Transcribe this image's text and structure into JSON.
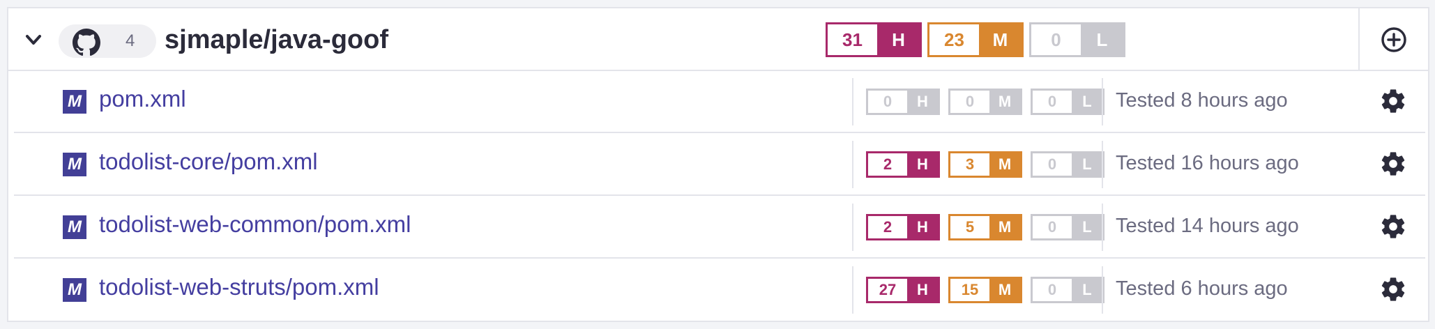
{
  "project": {
    "repo_count": "4",
    "repo_name": "sjmaple/java-goof",
    "issues": {
      "high": "31",
      "high_label": "H",
      "medium": "23",
      "medium_label": "M",
      "low": "0",
      "low_label": "L"
    }
  },
  "icons": {
    "collapse": "chevron-down-icon",
    "repo": "github-icon",
    "add": "plus-circle-icon",
    "file_type": "maven-icon",
    "settings": "gear-icon"
  },
  "file_icon_letter": "M",
  "colors": {
    "high": "#a8296a",
    "medium": "#d9872f",
    "low": "#c9c9cf",
    "link": "#443ea0",
    "maven_icon": "#423f96"
  },
  "files": [
    {
      "name": "pom.xml",
      "high": "0",
      "medium": "0",
      "low": "0",
      "h": "H",
      "m": "M",
      "l": "L",
      "tested": "Tested 8 hours ago"
    },
    {
      "name": "todolist-core/pom.xml",
      "high": "2",
      "medium": "3",
      "low": "0",
      "h": "H",
      "m": "M",
      "l": "L",
      "tested": "Tested 16 hours ago"
    },
    {
      "name": "todolist-web-common/pom.xml",
      "high": "2",
      "medium": "5",
      "low": "0",
      "h": "H",
      "m": "M",
      "l": "L",
      "tested": "Tested 14 hours ago"
    },
    {
      "name": "todolist-web-struts/pom.xml",
      "high": "27",
      "medium": "15",
      "low": "0",
      "h": "H",
      "m": "M",
      "l": "L",
      "tested": "Tested 6 hours ago"
    }
  ]
}
